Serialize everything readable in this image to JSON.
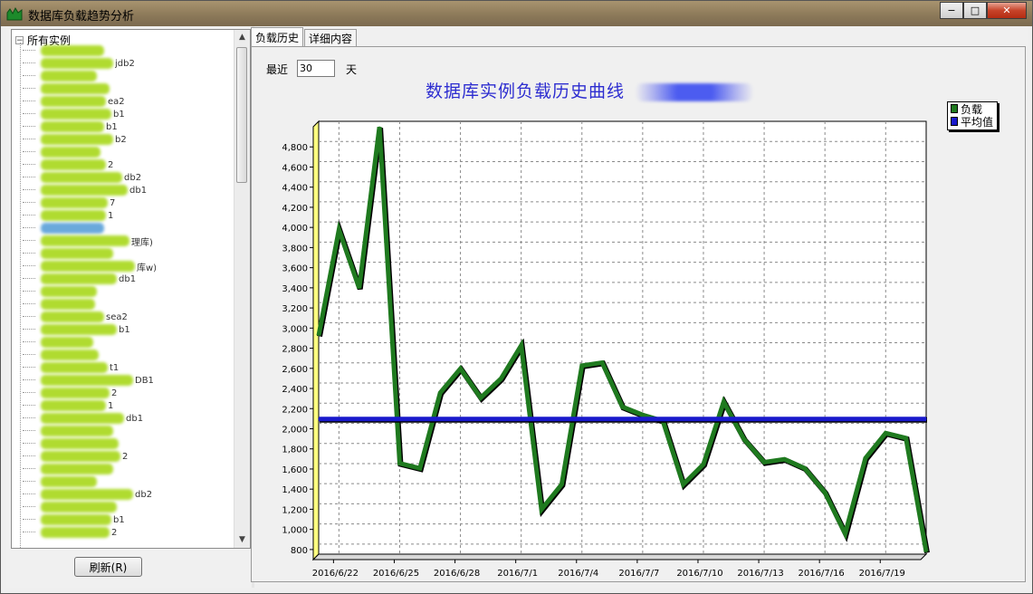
{
  "window": {
    "title": "数据库负载趋势分析",
    "minimize": "−",
    "maximize": "□",
    "close": "✕"
  },
  "tree": {
    "root_label": "所有实例",
    "root_expander": "−",
    "items": [
      {
        "tail": ""
      },
      {
        "tail": "jdb2"
      },
      {
        "tail": ""
      },
      {
        "tail": ""
      },
      {
        "tail": "ea2"
      },
      {
        "tail": "b1"
      },
      {
        "tail": "b1"
      },
      {
        "tail": "b2"
      },
      {
        "tail": ""
      },
      {
        "tail": "2"
      },
      {
        "tail": "db2"
      },
      {
        "tail": "db1"
      },
      {
        "tail": "7"
      },
      {
        "tail": "1"
      },
      {
        "tail": "",
        "selected": true
      },
      {
        "tail": "理库)"
      },
      {
        "tail": ""
      },
      {
        "tail": "库w)"
      },
      {
        "tail": "db1"
      },
      {
        "tail": ""
      },
      {
        "tail": ""
      },
      {
        "tail": "sea2"
      },
      {
        "tail": "b1"
      },
      {
        "tail": ""
      },
      {
        "tail": ""
      },
      {
        "tail": "t1"
      },
      {
        "tail": "DB1"
      },
      {
        "tail": "2"
      },
      {
        "tail": "1"
      },
      {
        "tail": "db1"
      },
      {
        "tail": ""
      },
      {
        "tail": ""
      },
      {
        "tail": "2"
      },
      {
        "tail": ""
      },
      {
        "tail": ""
      },
      {
        "tail": "db2"
      },
      {
        "tail": ""
      },
      {
        "tail": "b1"
      },
      {
        "tail": "2"
      }
    ],
    "refresh_label": "刷新(R)"
  },
  "tabs": [
    {
      "label": "负载历史",
      "active": true
    },
    {
      "label": "详细内容",
      "active": false
    }
  ],
  "filter": {
    "recent_label": "最近",
    "days_value": "30",
    "days_unit": "天"
  },
  "chart_data": {
    "type": "line",
    "title": "数据库实例负载历史曲线",
    "x": [
      "2016/6/21",
      "2016/6/22",
      "2016/6/23",
      "2016/6/24",
      "2016/6/25",
      "2016/6/26",
      "2016/6/27",
      "2016/6/28",
      "2016/6/29",
      "2016/6/30",
      "2016/7/1",
      "2016/7/2",
      "2016/7/3",
      "2016/7/4",
      "2016/7/5",
      "2016/7/6",
      "2016/7/7",
      "2016/7/8",
      "2016/7/9",
      "2016/7/10",
      "2016/7/11",
      "2016/7/12",
      "2016/7/13",
      "2016/7/14",
      "2016/7/15",
      "2016/7/16",
      "2016/7/17",
      "2016/7/18",
      "2016/7/19",
      "2016/7/20",
      "2016/7/21"
    ],
    "tick_labels": [
      "2016/6/22",
      "2016/6/25",
      "2016/6/28",
      "2016/7/1",
      "2016/7/4",
      "2016/7/7",
      "2016/7/10",
      "2016/7/13",
      "2016/7/16",
      "2016/7/19"
    ],
    "tick_indices": [
      1,
      4,
      7,
      10,
      13,
      16,
      19,
      22,
      25,
      28
    ],
    "series": [
      {
        "name": "负载",
        "color": "#1f7a1f",
        "values": [
          2900,
          3950,
          3370,
          4970,
          1630,
          1580,
          2330,
          2570,
          2280,
          2470,
          2800,
          1170,
          1420,
          2600,
          2630,
          2190,
          2110,
          2050,
          1420,
          1620,
          2240,
          1870,
          1640,
          1670,
          1580,
          1340,
          930,
          1680,
          1930,
          1880,
          750
        ]
      },
      {
        "name": "平均值",
        "color": "#1a1acc",
        "values": [
          2070,
          2070,
          2070,
          2070,
          2070,
          2070,
          2070,
          2070,
          2070,
          2070,
          2070,
          2070,
          2070,
          2070,
          2070,
          2070,
          2070,
          2070,
          2070,
          2070,
          2070,
          2070,
          2070,
          2070,
          2070,
          2070,
          2070,
          2070,
          2070,
          2070,
          2070
        ]
      }
    ],
    "y_ticks": [
      "800",
      "1,000",
      "1,200",
      "1,400",
      "1,600",
      "1,800",
      "2,000",
      "2,200",
      "2,400",
      "2,600",
      "2,800",
      "3,000",
      "3,200",
      "3,400",
      "3,600",
      "3,800",
      "4,000",
      "4,200",
      "4,400",
      "4,600",
      "4,800"
    ],
    "ylim": [
      700,
      5000
    ],
    "grid": true,
    "legend": "top-right",
    "wall_color": "#ffff80"
  }
}
